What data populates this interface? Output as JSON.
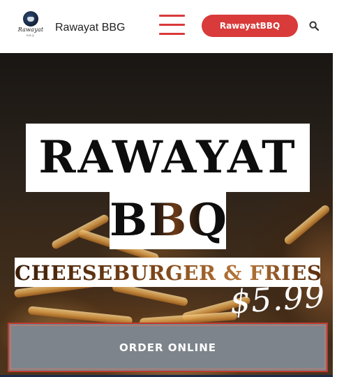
{
  "header": {
    "logo": {
      "word": "Rawayat",
      "sub": "BBQ"
    },
    "site_title": "Rawayat BBG",
    "cta_label": "RawayatBBQ",
    "menu_icon": "hamburger-menu-icon",
    "search_icon": "search-icon"
  },
  "hero": {
    "title_line1": "RAWAYAT",
    "title_line2": "BBQ",
    "promo": "CHEESEBURGER & FRIES",
    "price": "$5.99",
    "order_button": "ORDER ONLINE"
  },
  "colors": {
    "accent": "#d93a3a",
    "button_gray": "#7d848b",
    "button_border": "#c0392b"
  }
}
